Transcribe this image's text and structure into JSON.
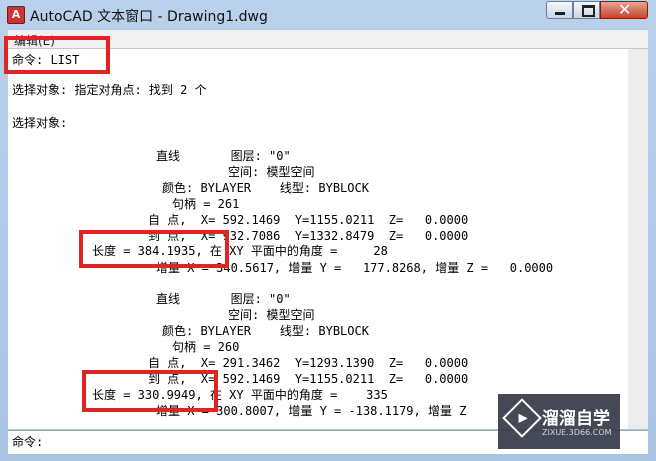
{
  "window": {
    "title": "AutoCAD 文本窗口 - Drawing1.dwg",
    "close_glyph": "✕"
  },
  "menubar": {
    "edit": "编辑(E)"
  },
  "lines": [
    "命令: LIST",
    "选择对象: 指定对角点: 找到 2 个",
    "选择对象:",
    "直线       图层: \"0\"",
    "空间: 模型空间",
    "颜色: BYLAYER    线型: BYBLOCK",
    "句柄 = 261",
    "自 点,  X= 592.1469  Y=1155.0211  Z=   0.0000",
    "到 点,  X= 932.7086  Y=1332.8479  Z=   0.0000",
    "长度 = 384.1935, 在 XY 平面中的角度 =     28",
    "增量 X = 340.5617, 增量 Y =   177.8268, 增量 Z =   0.0000",
    "直线       图层: \"0\"",
    "空间: 模型空间",
    "颜色: BYLAYER    线型: BYBLOCK",
    "句柄 = 260",
    "自 点,  X= 291.3462  Y=1293.1390  Z=   0.0000",
    "到 点,  X= 592.1469  Y=1155.0211  Z=   0.0000",
    "长度 = 330.9949, 在 XY 平面中的角度 =    335",
    "增量 X = 300.8007, 增量 Y = -138.1179, 增量 Z"
  ],
  "command_prompt": "命令:",
  "watermark": {
    "brand": "溜溜自学",
    "url": "ZIXUE.3D66.COM",
    "logo_glyph": "▶"
  },
  "colors": {
    "highlight": "#e02424"
  }
}
